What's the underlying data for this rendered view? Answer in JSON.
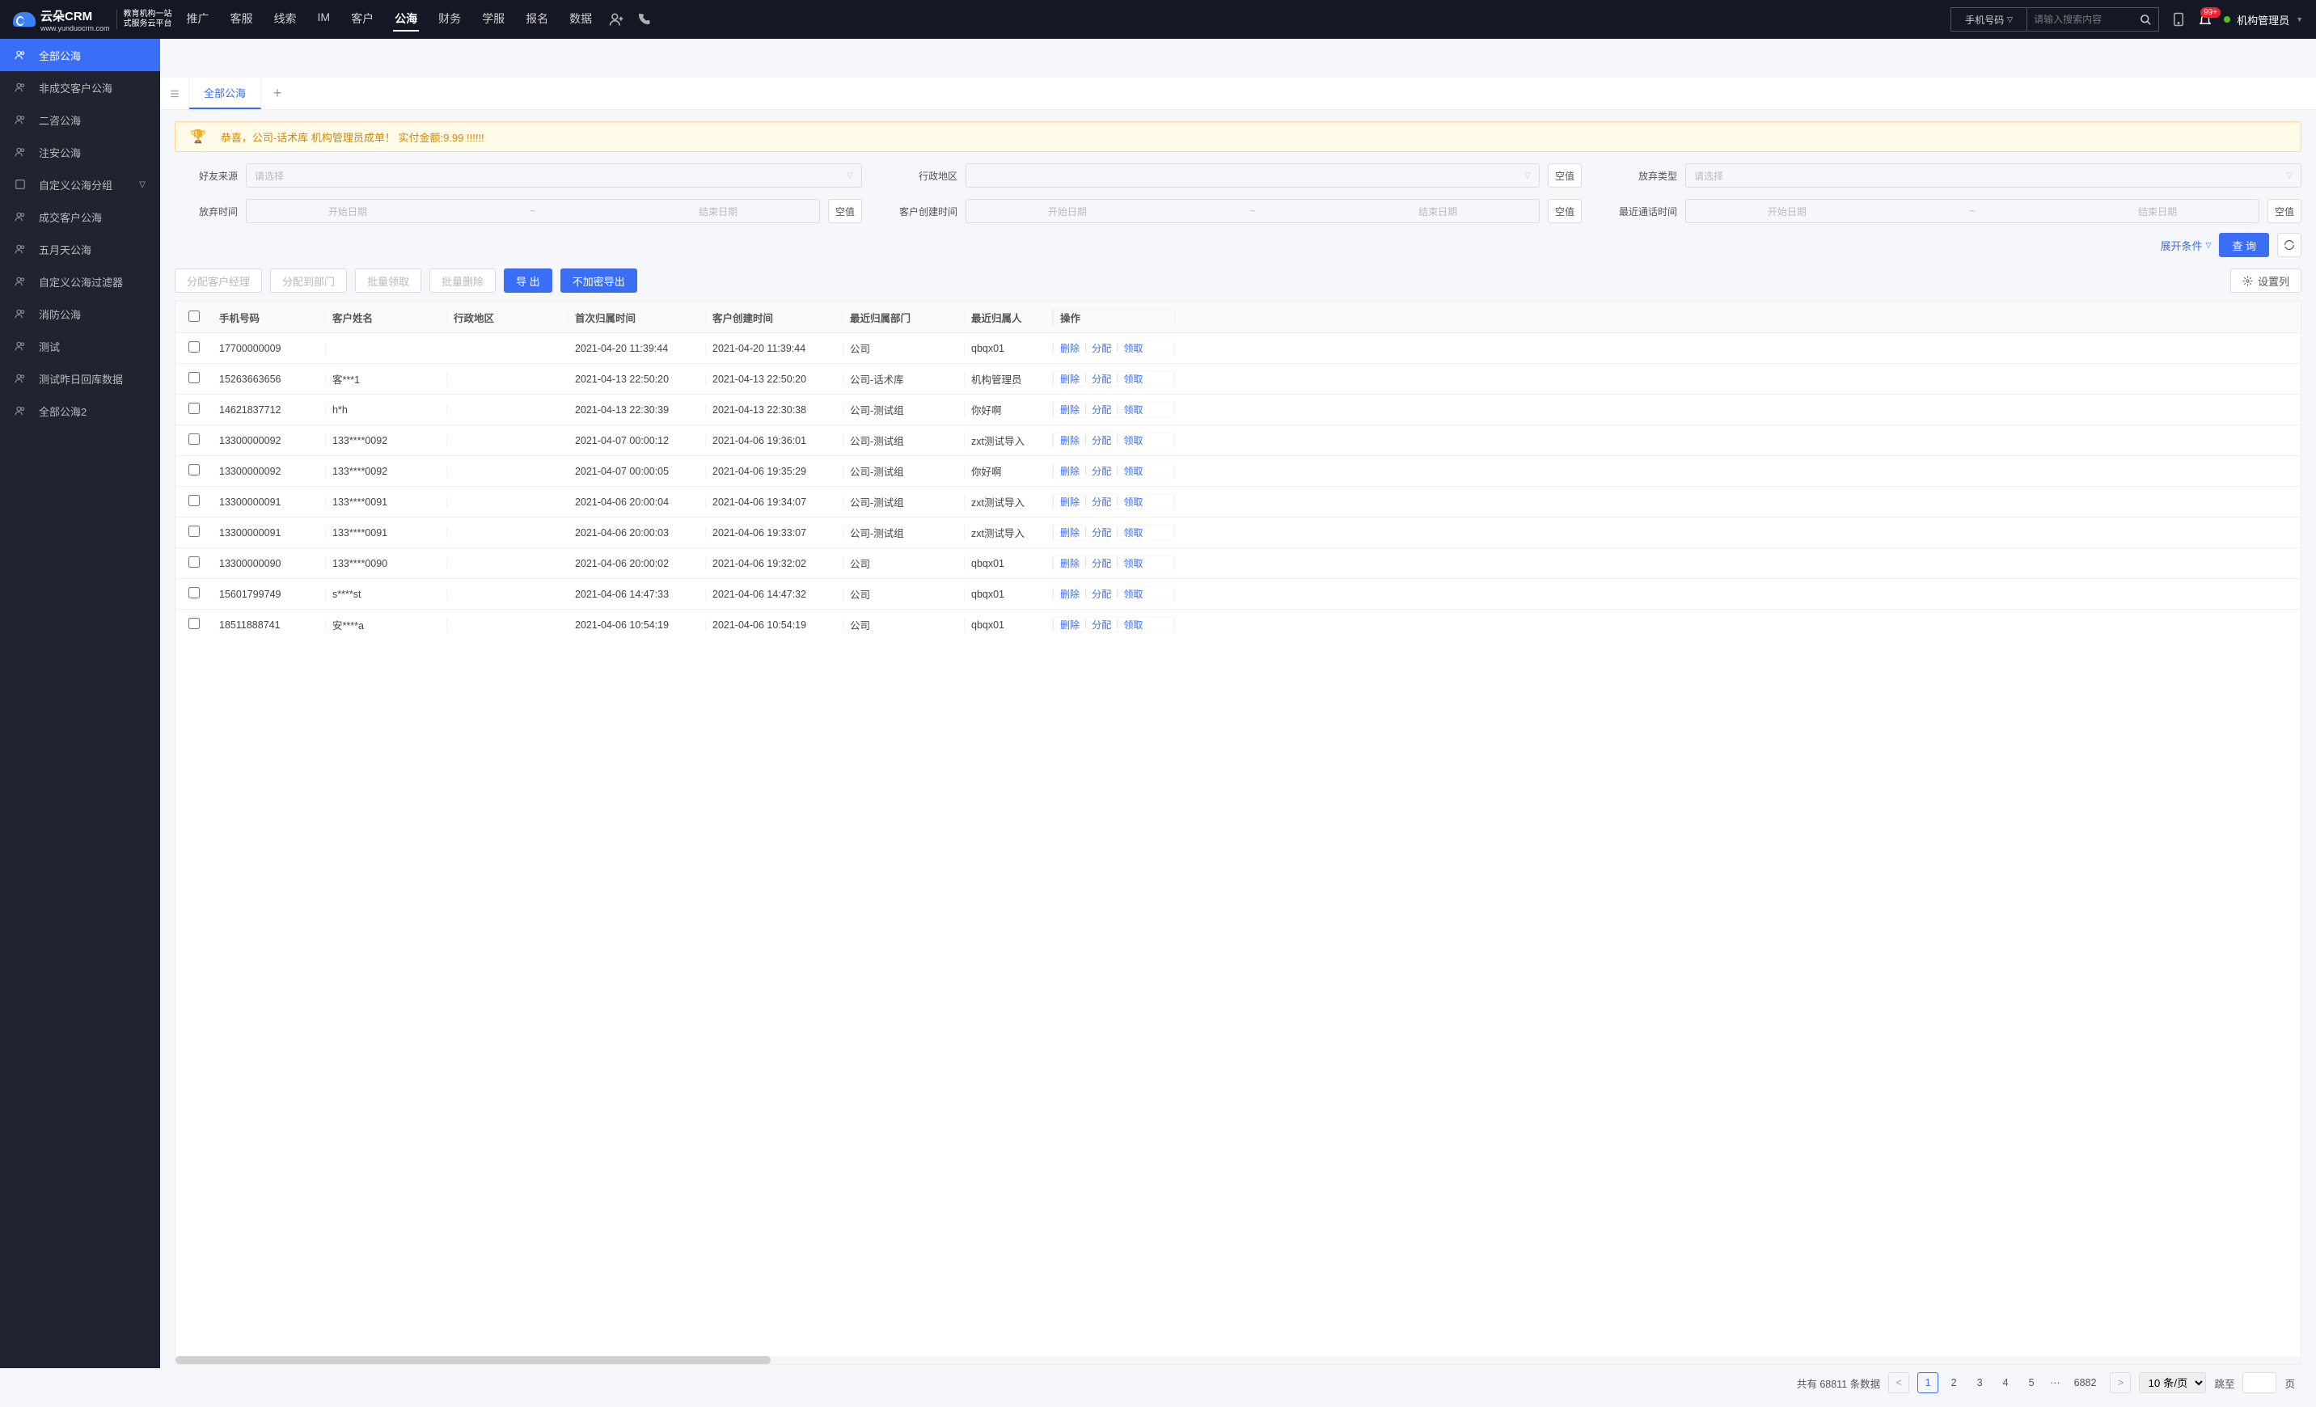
{
  "logo": {
    "brand": "云朵CRM",
    "url": "www.yunduocrm.com",
    "tag1": "教育机构一站",
    "tag2": "式服务云平台"
  },
  "nav": [
    "推广",
    "客服",
    "线索",
    "IM",
    "客户",
    "公海",
    "财务",
    "学服",
    "报名",
    "数据"
  ],
  "nav_active": 5,
  "search": {
    "type": "手机号码",
    "placeholder": "请输入搜索内容"
  },
  "badge": "99+",
  "user": "机构管理员",
  "sidebar": [
    {
      "label": "全部公海",
      "icon": "users"
    },
    {
      "label": "非成交客户公海",
      "icon": "users"
    },
    {
      "label": "二咨公海",
      "icon": "users"
    },
    {
      "label": "注安公海",
      "icon": "users"
    },
    {
      "label": "自定义公海分组",
      "icon": "box",
      "expandable": true
    },
    {
      "label": "成交客户公海",
      "icon": "users"
    },
    {
      "label": "五月天公海",
      "icon": "users"
    },
    {
      "label": "自定义公海过滤器",
      "icon": "users"
    },
    {
      "label": "消防公海",
      "icon": "users"
    },
    {
      "label": "测试",
      "icon": "users"
    },
    {
      "label": "测试昨日回库数据",
      "icon": "users"
    },
    {
      "label": "全部公海2",
      "icon": "users"
    }
  ],
  "sidebar_active": 0,
  "tab": "全部公海",
  "banner": "恭喜，公司-话术库  机构管理员成单！  实付金额:9.99 !!!!!!",
  "filters": {
    "friend_source": {
      "label": "好友来源",
      "ph": "请选择"
    },
    "region": {
      "label": "行政地区",
      "ph": ""
    },
    "abandon_type": {
      "label": "放弃类型",
      "ph": "请选择"
    },
    "abandon_time": {
      "label": "放弃时间"
    },
    "create_time": {
      "label": "客户创建时间"
    },
    "last_call": {
      "label": "最近通话时间"
    },
    "start_ph": "开始日期",
    "end_ph": "结束日期",
    "null_btn": "空值",
    "expand": "展开条件",
    "query": "查 询"
  },
  "toolbar": {
    "assign_mgr": "分配客户经理",
    "assign_dept": "分配到部门",
    "batch_take": "批量领取",
    "batch_del": "批量删除",
    "export": "导 出",
    "export_plain": "不加密导出",
    "set_cols": "设置列"
  },
  "columns": [
    "手机号码",
    "客户姓名",
    "行政地区",
    "首次归属时间",
    "客户创建时间",
    "最近归属部门",
    "最近归属人",
    "操作"
  ],
  "ops": {
    "del": "删除",
    "assign": "分配",
    "take": "领取"
  },
  "rows": [
    {
      "phone": "17700000009",
      "name": "",
      "region": "",
      "first": "2021-04-20 11:39:44",
      "created": "2021-04-20 11:39:44",
      "dept": "公司",
      "owner": "qbqx01"
    },
    {
      "phone": "15263663656",
      "name": "客***1",
      "region": "",
      "first": "2021-04-13 22:50:20",
      "created": "2021-04-13 22:50:20",
      "dept": "公司-话术库",
      "owner": "机构管理员"
    },
    {
      "phone": "14621837712",
      "name": "h*h",
      "region": "",
      "first": "2021-04-13 22:30:39",
      "created": "2021-04-13 22:30:38",
      "dept": "公司-测试组",
      "owner": "你好啊"
    },
    {
      "phone": "13300000092",
      "name": "133****0092",
      "region": "",
      "first": "2021-04-07 00:00:12",
      "created": "2021-04-06 19:36:01",
      "dept": "公司-测试组",
      "owner": "zxt测试导入"
    },
    {
      "phone": "13300000092",
      "name": "133****0092",
      "region": "",
      "first": "2021-04-07 00:00:05",
      "created": "2021-04-06 19:35:29",
      "dept": "公司-测试组",
      "owner": "你好啊"
    },
    {
      "phone": "13300000091",
      "name": "133****0091",
      "region": "",
      "first": "2021-04-06 20:00:04",
      "created": "2021-04-06 19:34:07",
      "dept": "公司-测试组",
      "owner": "zxt测试导入"
    },
    {
      "phone": "13300000091",
      "name": "133****0091",
      "region": "",
      "first": "2021-04-06 20:00:03",
      "created": "2021-04-06 19:33:07",
      "dept": "公司-测试组",
      "owner": "zxt测试导入"
    },
    {
      "phone": "13300000090",
      "name": "133****0090",
      "region": "",
      "first": "2021-04-06 20:00:02",
      "created": "2021-04-06 19:32:02",
      "dept": "公司",
      "owner": "qbqx01"
    },
    {
      "phone": "15601799749",
      "name": "s****st",
      "region": "",
      "first": "2021-04-06 14:47:33",
      "created": "2021-04-06 14:47:32",
      "dept": "公司",
      "owner": "qbqx01"
    },
    {
      "phone": "18511888741",
      "name": "安****a",
      "region": "",
      "first": "2021-04-06 10:54:19",
      "created": "2021-04-06 10:54:19",
      "dept": "公司",
      "owner": "qbqx01"
    }
  ],
  "pager": {
    "total_prefix": "共有",
    "total": "68811",
    "total_suffix": "条数据",
    "pages": [
      "1",
      "2",
      "3",
      "4",
      "5"
    ],
    "last": "6882",
    "page_size": "10 条/页",
    "jump_label": "跳至",
    "page_suffix": "页"
  }
}
